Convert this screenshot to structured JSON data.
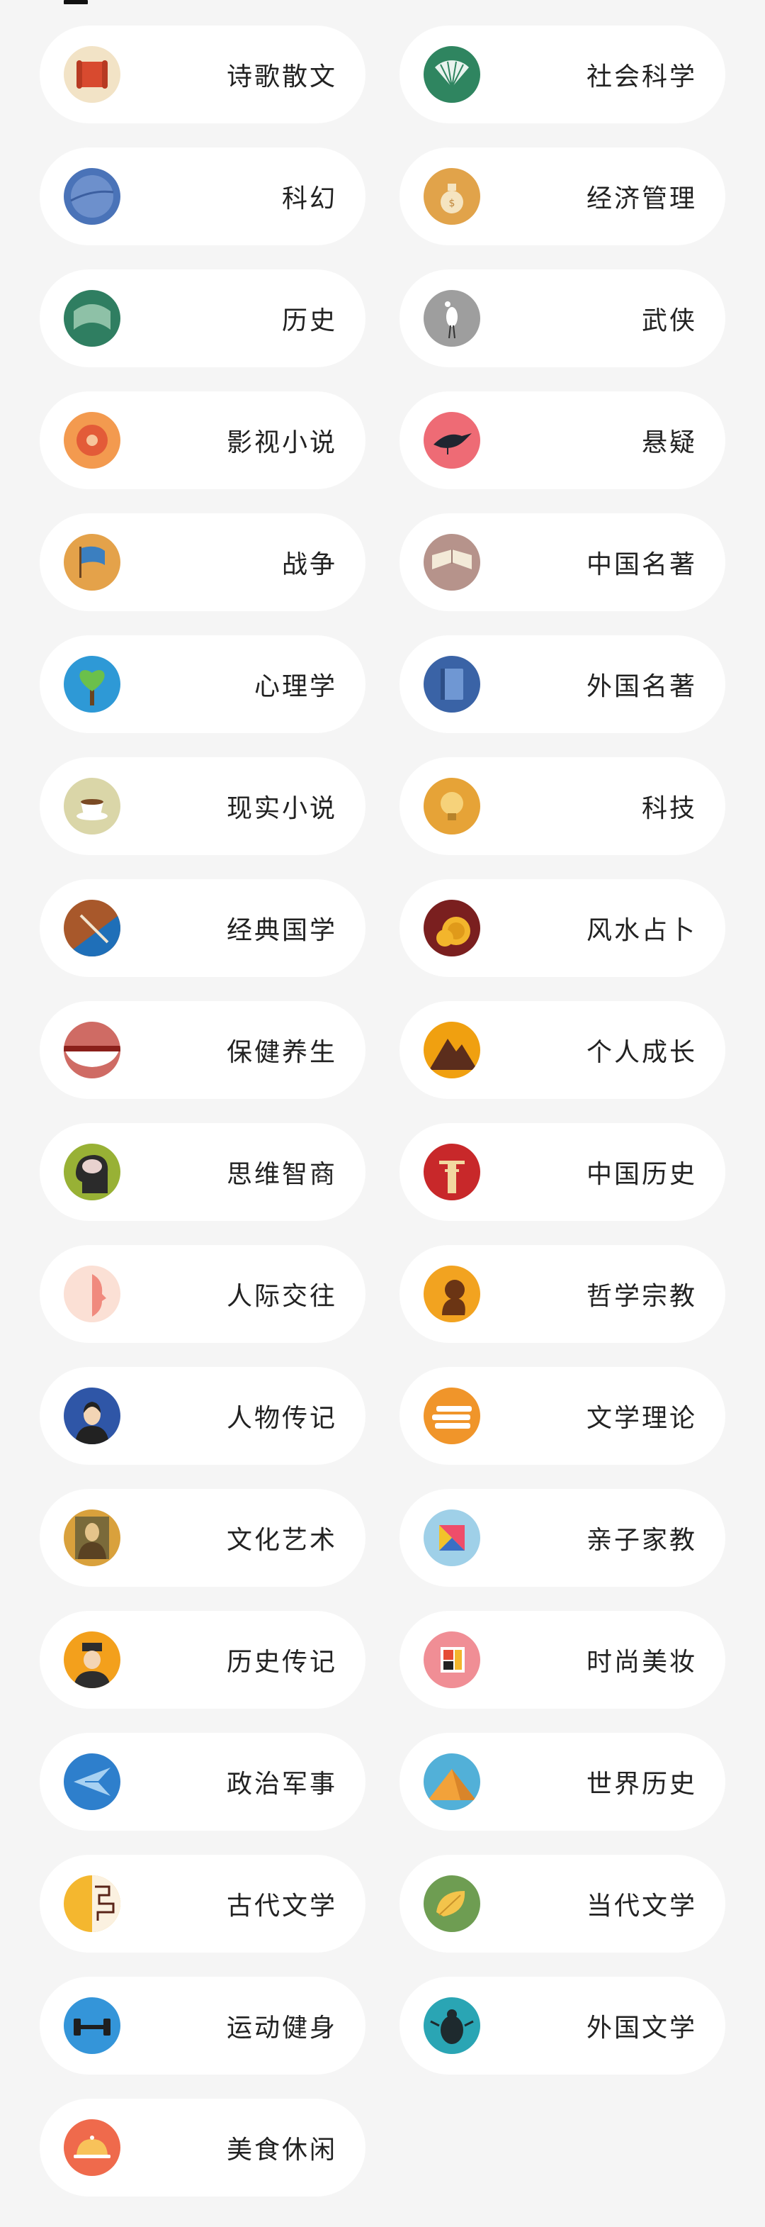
{
  "categories": [
    {
      "label": "诗歌散文",
      "icon": "scroll-icon",
      "color": "#f2e3c6",
      "accent": "#d84a2f"
    },
    {
      "label": "社会科学",
      "icon": "fan-icon",
      "color": "#2f8560",
      "accent": "#e9f3ee"
    },
    {
      "label": "科幻",
      "icon": "planet-icon",
      "color": "#4a73b8",
      "accent": "#6d90cc"
    },
    {
      "label": "经济管理",
      "icon": "money-bag-icon",
      "color": "#e1a34a",
      "accent": "#f5e4c0"
    },
    {
      "label": "历史",
      "icon": "scroll-wave-icon",
      "color": "#2f7e61",
      "accent": "#8ec1a7"
    },
    {
      "label": "武侠",
      "icon": "crane-icon",
      "color": "#9e9e9e",
      "accent": "#ffffff"
    },
    {
      "label": "影视小说",
      "icon": "film-reel-icon",
      "color": "#f39a4f",
      "accent": "#e35b38"
    },
    {
      "label": "悬疑",
      "icon": "crow-icon",
      "color": "#ee6b75",
      "accent": "#1f2530"
    },
    {
      "label": "战争",
      "icon": "flag-icon",
      "color": "#e4a24a",
      "accent": "#3b7fc0"
    },
    {
      "label": "中国名著",
      "icon": "open-book-icon",
      "color": "#b6938b",
      "accent": "#f3ead8"
    },
    {
      "label": "心理学",
      "icon": "heart-tree-icon",
      "color": "#2e99d6",
      "accent": "#6bc04b"
    },
    {
      "label": "外国名著",
      "icon": "book-icon",
      "color": "#3a63a6",
      "accent": "#6f97d3"
    },
    {
      "label": "现实小说",
      "icon": "tea-cup-icon",
      "color": "#dad6a8",
      "accent": "#ffffff"
    },
    {
      "label": "科技",
      "icon": "lightbulb-icon",
      "color": "#e6a337",
      "accent": "#f6d27a"
    },
    {
      "label": "经典国学",
      "icon": "ink-brush-icon",
      "color": "#a8582b",
      "accent": "#1f6fb8"
    },
    {
      "label": "风水占卜",
      "icon": "coins-icon",
      "color": "#7a1f1f",
      "accent": "#f3b52c"
    },
    {
      "label": "保健养生",
      "icon": "soup-bowl-icon",
      "color": "#cf6b64",
      "accent": "#ffffff"
    },
    {
      "label": "个人成长",
      "icon": "mountain-icon",
      "color": "#f0a010",
      "accent": "#5b2d1c"
    },
    {
      "label": "思维智商",
      "icon": "brain-head-icon",
      "color": "#98b135",
      "accent": "#2b2b2b"
    },
    {
      "label": "中国历史",
      "icon": "pillar-icon",
      "color": "#c8282a",
      "accent": "#f2d8a0"
    },
    {
      "label": "人际交往",
      "icon": "face-profile-icon",
      "color": "#fbe0d5",
      "accent": "#f08a7e"
    },
    {
      "label": "哲学宗教",
      "icon": "thinker-icon",
      "color": "#f2a320",
      "accent": "#6b3514"
    },
    {
      "label": "人物传记",
      "icon": "portrait-icon",
      "color": "#2f56a7",
      "accent": "#f3d5b5"
    },
    {
      "label": "文学理论",
      "icon": "books-stack-icon",
      "color": "#f0952a",
      "accent": "#ffffff"
    },
    {
      "label": "文化艺术",
      "icon": "mona-lisa-icon",
      "color": "#d9a13c",
      "accent": "#5a4223"
    },
    {
      "label": "亲子家教",
      "icon": "tangram-icon",
      "color": "#9fd0e8",
      "accent": "#ef4d6a"
    },
    {
      "label": "历史传记",
      "icon": "emperor-icon",
      "color": "#f3a01c",
      "accent": "#2d2d2d"
    },
    {
      "label": "时尚美妆",
      "icon": "color-blocks-icon",
      "color": "#f08e95",
      "accent": "#e54b34"
    },
    {
      "label": "政治军事",
      "icon": "plane-icon",
      "color": "#2e7fcc",
      "accent": "#a7d1f2"
    },
    {
      "label": "世界历史",
      "icon": "pyramid-icon",
      "color": "#52b0d8",
      "accent": "#f2a23a"
    },
    {
      "label": "古代文学",
      "icon": "maze-icon",
      "color": "#f4b72f",
      "accent": "#5a2418"
    },
    {
      "label": "当代文学",
      "icon": "leaf-icon",
      "color": "#6e9d52",
      "accent": "#f3c44b"
    },
    {
      "label": "运动健身",
      "icon": "dumbbell-icon",
      "color": "#3495d9",
      "accent": "#1f1f1f"
    },
    {
      "label": "外国文学",
      "icon": "beetle-icon",
      "color": "#2aa5b4",
      "accent": "#1e2a2e"
    },
    {
      "label": "美食休闲",
      "icon": "cloche-icon",
      "color": "#ef6a4c",
      "accent": "#f8c25a"
    }
  ]
}
